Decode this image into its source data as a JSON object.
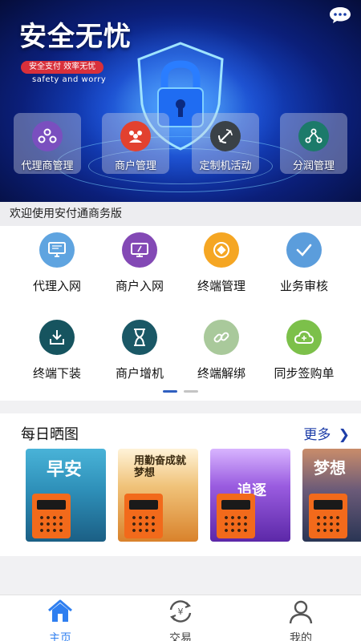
{
  "banner": {
    "title": "安全无忧",
    "badge": "安全支付  效率无忧",
    "subtitle": "safety  and  worry"
  },
  "quick_tiles": [
    {
      "label": "代理商管理",
      "icon": "circles-icon",
      "color": "#7a4fbf"
    },
    {
      "label": "商户管理",
      "icon": "people-icon",
      "color": "#e2412f"
    },
    {
      "label": "定制机活动",
      "icon": "satellite-icon",
      "color": "#3a4147"
    },
    {
      "label": "分润管理",
      "icon": "share-icon",
      "color": "#1c7a6a"
    }
  ],
  "welcome_text": "欢迎使用安付通商务版",
  "grid": [
    {
      "label": "代理入网",
      "icon": "monitor-icon",
      "color": "#5fa4e0"
    },
    {
      "label": "商户入网",
      "icon": "screen-icon",
      "color": "#8349b5"
    },
    {
      "label": "终端管理",
      "icon": "coin-icon",
      "color": "#f5a623"
    },
    {
      "label": "业务审核",
      "icon": "check-icon",
      "color": "#5b9ddc"
    },
    {
      "label": "终端下装",
      "icon": "download-icon",
      "color": "#16545f"
    },
    {
      "label": "商户增机",
      "icon": "hourglass-icon",
      "color": "#1a5866"
    },
    {
      "label": "终端解绑",
      "icon": "link-icon",
      "color": "#a9c99b"
    },
    {
      "label": "同步签购单",
      "icon": "cloud-icon",
      "color": "#7cc04a"
    }
  ],
  "daily": {
    "title": "每日晒图",
    "more": "更多",
    "posters": [
      {
        "word": "早安",
        "bg": "#2e8fb8"
      },
      {
        "word": "用勤奋成就梦想",
        "bg": "#d89a3a"
      },
      {
        "word": "追逐",
        "bg": "#7e3fc8"
      },
      {
        "word": "梦想",
        "bg": "#3b4a73"
      }
    ]
  },
  "tabs": [
    {
      "label": "主页",
      "icon": "home-icon",
      "active": true
    },
    {
      "label": "交易",
      "icon": "exchange-icon",
      "active": false
    },
    {
      "label": "我的",
      "icon": "user-icon",
      "active": false
    }
  ],
  "colors": {
    "accent": "#2f7ff0",
    "banner_badge": "#d8303b",
    "more_link": "#1e3ea8"
  }
}
